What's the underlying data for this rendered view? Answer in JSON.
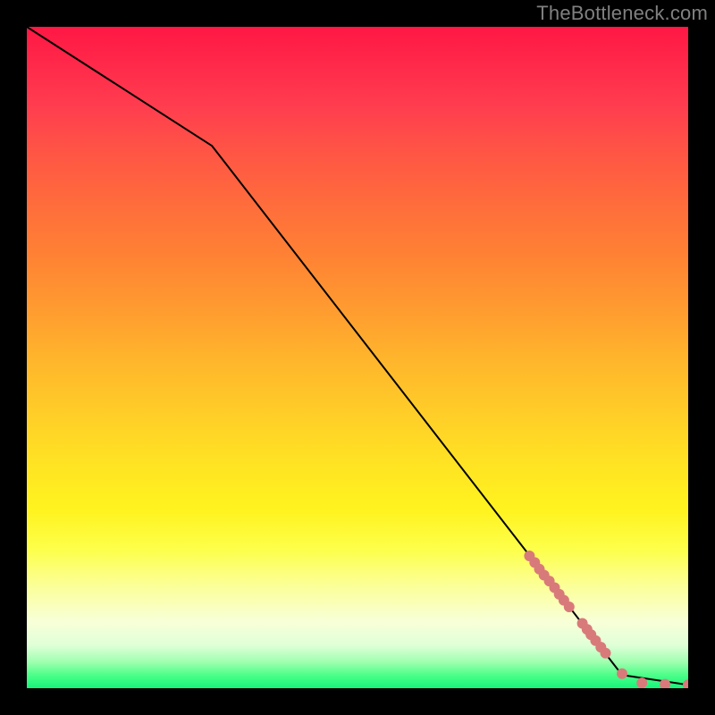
{
  "watermark": "TheBottleneck.com",
  "chart_data": {
    "type": "line",
    "title": "",
    "xlabel": "",
    "ylabel": "",
    "xlim": [
      0,
      100
    ],
    "ylim": [
      0,
      100
    ],
    "grid": false,
    "line": {
      "points": [
        {
          "x": 0,
          "y": 100
        },
        {
          "x": 28,
          "y": 82
        },
        {
          "x": 90,
          "y": 2
        },
        {
          "x": 100,
          "y": 0.5
        }
      ],
      "color": "#000000",
      "width": 2
    },
    "markers": {
      "color": "#d97a7a",
      "radius": 6,
      "points": [
        {
          "x": 76.0,
          "y": 20.0
        },
        {
          "x": 76.8,
          "y": 19.0
        },
        {
          "x": 77.5,
          "y": 18.0
        },
        {
          "x": 78.2,
          "y": 17.1
        },
        {
          "x": 79.0,
          "y": 16.2
        },
        {
          "x": 79.8,
          "y": 15.2
        },
        {
          "x": 80.5,
          "y": 14.2
        },
        {
          "x": 81.2,
          "y": 13.3
        },
        {
          "x": 82.0,
          "y": 12.3
        },
        {
          "x": 84.0,
          "y": 9.8
        },
        {
          "x": 84.7,
          "y": 8.9
        },
        {
          "x": 85.3,
          "y": 8.1
        },
        {
          "x": 86.0,
          "y": 7.2
        },
        {
          "x": 86.8,
          "y": 6.2
        },
        {
          "x": 87.5,
          "y": 5.3
        },
        {
          "x": 90.0,
          "y": 2.2
        },
        {
          "x": 93.0,
          "y": 0.8
        },
        {
          "x": 96.5,
          "y": 0.6
        },
        {
          "x": 100.0,
          "y": 0.5
        }
      ]
    }
  }
}
